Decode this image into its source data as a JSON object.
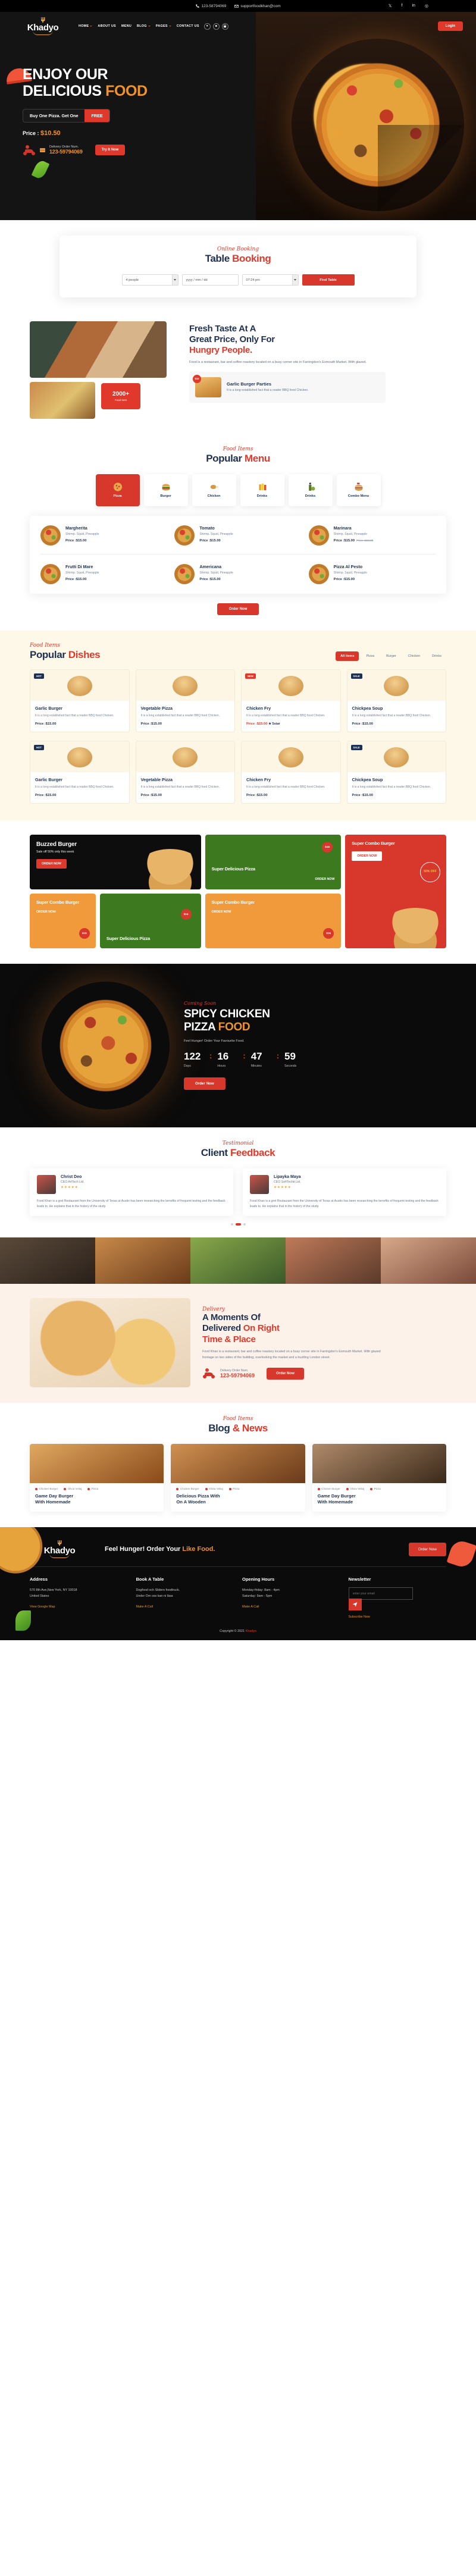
{
  "topbar": {
    "phone": "123-58794069",
    "email": "supportfoodkhan@com",
    "socials": [
      "twitter-icon",
      "facebook-icon",
      "linkedin-icon",
      "instagram-icon"
    ],
    "social_glyphs": [
      "𝕏",
      "f",
      "in",
      "◎"
    ]
  },
  "header": {
    "logo": "Khadyo",
    "nav": [
      {
        "label": "HOME",
        "has_caret": true
      },
      {
        "label": "ABOUT US",
        "has_caret": false
      },
      {
        "label": "MENU",
        "has_caret": false
      },
      {
        "label": "BLOG",
        "has_caret": true
      },
      {
        "label": "PAGES",
        "has_caret": true
      },
      {
        "label": "CONTACT US",
        "has_caret": false
      }
    ],
    "icons": [
      "heart-icon",
      "user-icon",
      "cart-icon"
    ],
    "icon_glyphs": [
      "♥",
      "☻",
      "🛒"
    ],
    "login_label": "Login"
  },
  "hero": {
    "title_line1": "ENJOY OUR",
    "title_line2_white": "DELICIOUS",
    "title_line2_orange": "FOOD",
    "offer_text": "Buy One Pizza. Get One",
    "offer_free": "FREE",
    "price_label": "Price :",
    "price_value": "$10.50",
    "delivery_label": "Delivery Order Num.",
    "delivery_number": "123-59794069",
    "try_now": "Try It Now"
  },
  "booking": {
    "eyebrow": "Online Booking",
    "title_dark": "Table",
    "title_red": "Booking",
    "people_value": "4 people",
    "date_placeholder": "yyyy / mm / dd",
    "time_value": "07:24 pm",
    "find_label": "Find Table"
  },
  "about": {
    "badge_number": "2000+",
    "badge_text": "Food Item",
    "heading_line1": "Fresh Taste At A",
    "heading_line2": "Great Price, Only For",
    "heading_line3_red": "Hungry People.",
    "paragraph": "Food is a restaurant, bar and coffee roastery located on a busy corner site in Farringdon's Exmouth Market. With glazed.",
    "card_price": "$15",
    "card_title": "Garlic Burger Parties",
    "card_desc": "It is a long established fact that a reader BBQ food Chicken."
  },
  "popular_menu": {
    "eyebrow": "Food Items",
    "title_dark": "Popular",
    "title_red": "Menu",
    "categories": [
      {
        "label": "Pizza",
        "icon": "pizza-icon",
        "active": true
      },
      {
        "label": "Burger",
        "icon": "burger-icon",
        "active": false
      },
      {
        "label": "Chicken",
        "icon": "chicken-icon",
        "active": false
      },
      {
        "label": "Drinks",
        "icon": "juice-icon",
        "active": false
      },
      {
        "label": "Drinks",
        "icon": "oil-icon",
        "active": false
      },
      {
        "label": "Combo Menu",
        "icon": "combo-icon",
        "active": false
      }
    ],
    "items": [
      {
        "name": "Margherita",
        "desc": "Shirmp. Squid, Pineapple",
        "price": "Price :$15.00",
        "old": ""
      },
      {
        "name": "Tomato",
        "desc": "Shirmp. Squid, Pineapple",
        "price": "Price :$15.00",
        "old": ""
      },
      {
        "name": "Marinara",
        "desc": "Shirmp. Squid, Pineapple",
        "price": "Price :$15.00",
        "old": "Price :$15.00"
      },
      {
        "name": "Frutti Di Mare",
        "desc": "Shirmp. Squid, Pineapple",
        "price": "Price :$15.00",
        "old": ""
      },
      {
        "name": "Americana",
        "desc": "Shirmp. Squid, Pineapple",
        "price": "Price :$15.00",
        "old": ""
      },
      {
        "name": "Pizza Al Pesto",
        "desc": "Shirmp. Squid, Pineapple",
        "price": "Price :$15.00",
        "old": ""
      }
    ],
    "order_label": "Order Now"
  },
  "popular_dishes": {
    "eyebrow": "Food Items",
    "title_dark": "Popular",
    "title_red": "Dishes",
    "tabs": [
      {
        "label": "All Items",
        "active": true
      },
      {
        "label": "Pizza",
        "active": false
      },
      {
        "label": "Burger",
        "active": false
      },
      {
        "label": "Chicken",
        "active": false
      },
      {
        "label": "Drinks",
        "active": false
      }
    ],
    "dishes": [
      {
        "tag": "HOT",
        "tag_type": "dark",
        "name": "Garlic Burger",
        "desc": "It is a long established fact that a reader BBQ food Chicken.",
        "price": "Price :$15.00",
        "red": false,
        "star": ""
      },
      {
        "tag": "",
        "tag_type": "",
        "name": "Vegetable Pizza",
        "desc": "It is a long established fact that a reader BBQ food Chicken.",
        "price": "Price :$15.00",
        "red": false,
        "star": ""
      },
      {
        "tag": "NEW",
        "tag_type": "red",
        "name": "Chicken Fry",
        "desc": "It is a long established fact that a reader BBQ food Chicken.",
        "price": "Price :$15.00",
        "red": true,
        "star": "★ 5star"
      },
      {
        "tag": "SALE",
        "tag_type": "dark",
        "name": "Chickpea Soup",
        "desc": "It is a long established fact that a reader BBQ food Chicken.",
        "price": "Price :$15.00",
        "red": false,
        "star": ""
      },
      {
        "tag": "HOT",
        "tag_type": "dark",
        "name": "Garlic Burger",
        "desc": "It is a long established fact that a reader BBQ food Chicken.",
        "price": "Price :$15.00",
        "red": false,
        "star": ""
      },
      {
        "tag": "",
        "tag_type": "",
        "name": "Vegetable Pizza",
        "desc": "It is a long established fact that a reader BBQ food Chicken.",
        "price": "Price :$15.00",
        "red": false,
        "star": ""
      },
      {
        "tag": "",
        "tag_type": "",
        "name": "Chicken Fry",
        "desc": "It is a long established fact that a reader BBQ food Chicken.",
        "price": "Price :$15.00",
        "red": false,
        "star": ""
      },
      {
        "tag": "SALE",
        "tag_type": "dark",
        "name": "Chickpea Soup",
        "desc": "It is a long established fact that a reader BBQ food Chicken.",
        "price": "Price :$15.00",
        "red": false,
        "star": ""
      }
    ]
  },
  "promo": {
    "buzzed_title": "Buzzed Burger",
    "buzzed_sub": "Sale off 50% only this week",
    "buzzed_btn": "ORDER NOW",
    "green_title": "Super Delicious Pizza",
    "green_link": "ORDER NOW",
    "green_price": "$15",
    "red_title": "Super Combo Burger",
    "red_btn": "ORDER NOW",
    "red_off": "50% OFF",
    "or1_title": "Super Combo Burger",
    "or1_link": "ORDER NOW",
    "or1_price": "$15",
    "green2_title": "Super Delicious Pizza",
    "or2_title": "Super Combo Burger",
    "or2_link": "ORDER NOW",
    "or2_price": "$15"
  },
  "countdown": {
    "eyebrow": "Coming Soon",
    "title_line1": "SPICY CHICKEN",
    "title_line2_white": "PIZZA",
    "title_line2_orange": "FOOD",
    "subtitle": "Feel Hunger! Order Your Favourite Food.",
    "units": [
      {
        "value": "122",
        "label": "Days"
      },
      {
        "value": "16",
        "label": "Hours"
      },
      {
        "value": "47",
        "label": "Minutes"
      },
      {
        "value": "59",
        "label": "Seconds"
      }
    ],
    "button": "Order Now"
  },
  "testimonial": {
    "eyebrow": "Testimonial",
    "title_dark": "Client",
    "title_red": "Feedback",
    "cards": [
      {
        "name": "Christ Deo",
        "role": "CEO A4Tech Ltd.",
        "stars": "★★★★★",
        "quote": "Food Khan is a gret Restaurant from the University of Texas at Austin has been researching the benefits of frequent testing and the feedback leads to. He explains that in the history of the study."
      },
      {
        "name": "Lipayka Maya",
        "role": "CEO SoftTechit Ltd.",
        "stars": "★★★★★",
        "quote": "Food Khan is a gret Restaurant from the University of Texas at Austin has been researching the benefits of frequent testing and the feedback leads to. He explains that in the history of the study."
      }
    ]
  },
  "delivery": {
    "eyebrow": "Delivery",
    "title_line1": "A Moments Of",
    "title_line2_dark": "Delivered",
    "title_line2_red": "On Right",
    "title_line3_red": "Time & Place",
    "paragraph": "Food Khan is a restaurant, bar and coffee roastery located on a busy corner site in Farringdon's Exmouth Market. With glazed frontage on two sides of the building, overlooking the market and a bustling London street.",
    "call_label": "Delivery Order Num.",
    "call_number": "123-59794069",
    "button": "Order Now"
  },
  "blog": {
    "eyebrow": "Food Items",
    "title_dark": "Blog",
    "title_red": "& News",
    "posts": [
      {
        "cat": "Chicken Burger",
        "date": "Olivia Veliaj",
        "tag": "Pizza",
        "title_line1": "Game Day Burger",
        "title_line2": "With Homemade"
      },
      {
        "cat": "Chicken Burger",
        "date": "Olivia Veliaj",
        "tag": "Pizza",
        "title_line1": "Delicious Pizza With",
        "title_line2": "On A Wooden"
      },
      {
        "cat": "Chicken Burger",
        "date": "Olivia Veliaj",
        "tag": "Pizza",
        "title_line1": "Game Day Burger",
        "title_line2": "With Homemade"
      }
    ]
  },
  "footer": {
    "logo": "Khadyo",
    "slogan_dark": "Feel Hunger! Order Your",
    "slogan_orange": "Like Food.",
    "order_btn": "Order Now",
    "columns": [
      {
        "heading": "Address",
        "lines": [
          "570 8th Ave,New York, NY 10018",
          "United States"
        ],
        "link": "View Google Map"
      },
      {
        "heading": "Book A Table",
        "lines": [
          "Dogfood och Sliders foodtruck.",
          "Under Om oss kan ni läsa"
        ],
        "link": "Make A Call"
      },
      {
        "heading": "Opening Hours",
        "lines": [
          "Monday-friday: 8am - 4pm",
          "Saturday: 9am - 5pm"
        ],
        "link": "Make A Call"
      }
    ],
    "newsletter_heading": "Newsletter",
    "newsletter_placeholder": "enter your email",
    "send_icon": "send-icon",
    "subscribe_link": "Subscribe Now",
    "copyright_prefix": "Copyright © 2021",
    "copyright_brand": "Khadyo"
  },
  "colors": {
    "red": "#d8372c",
    "navy": "#1e3050",
    "orange": "#f0932a",
    "cream": "#fdf8e8",
    "dark": "#0b0b0b"
  }
}
